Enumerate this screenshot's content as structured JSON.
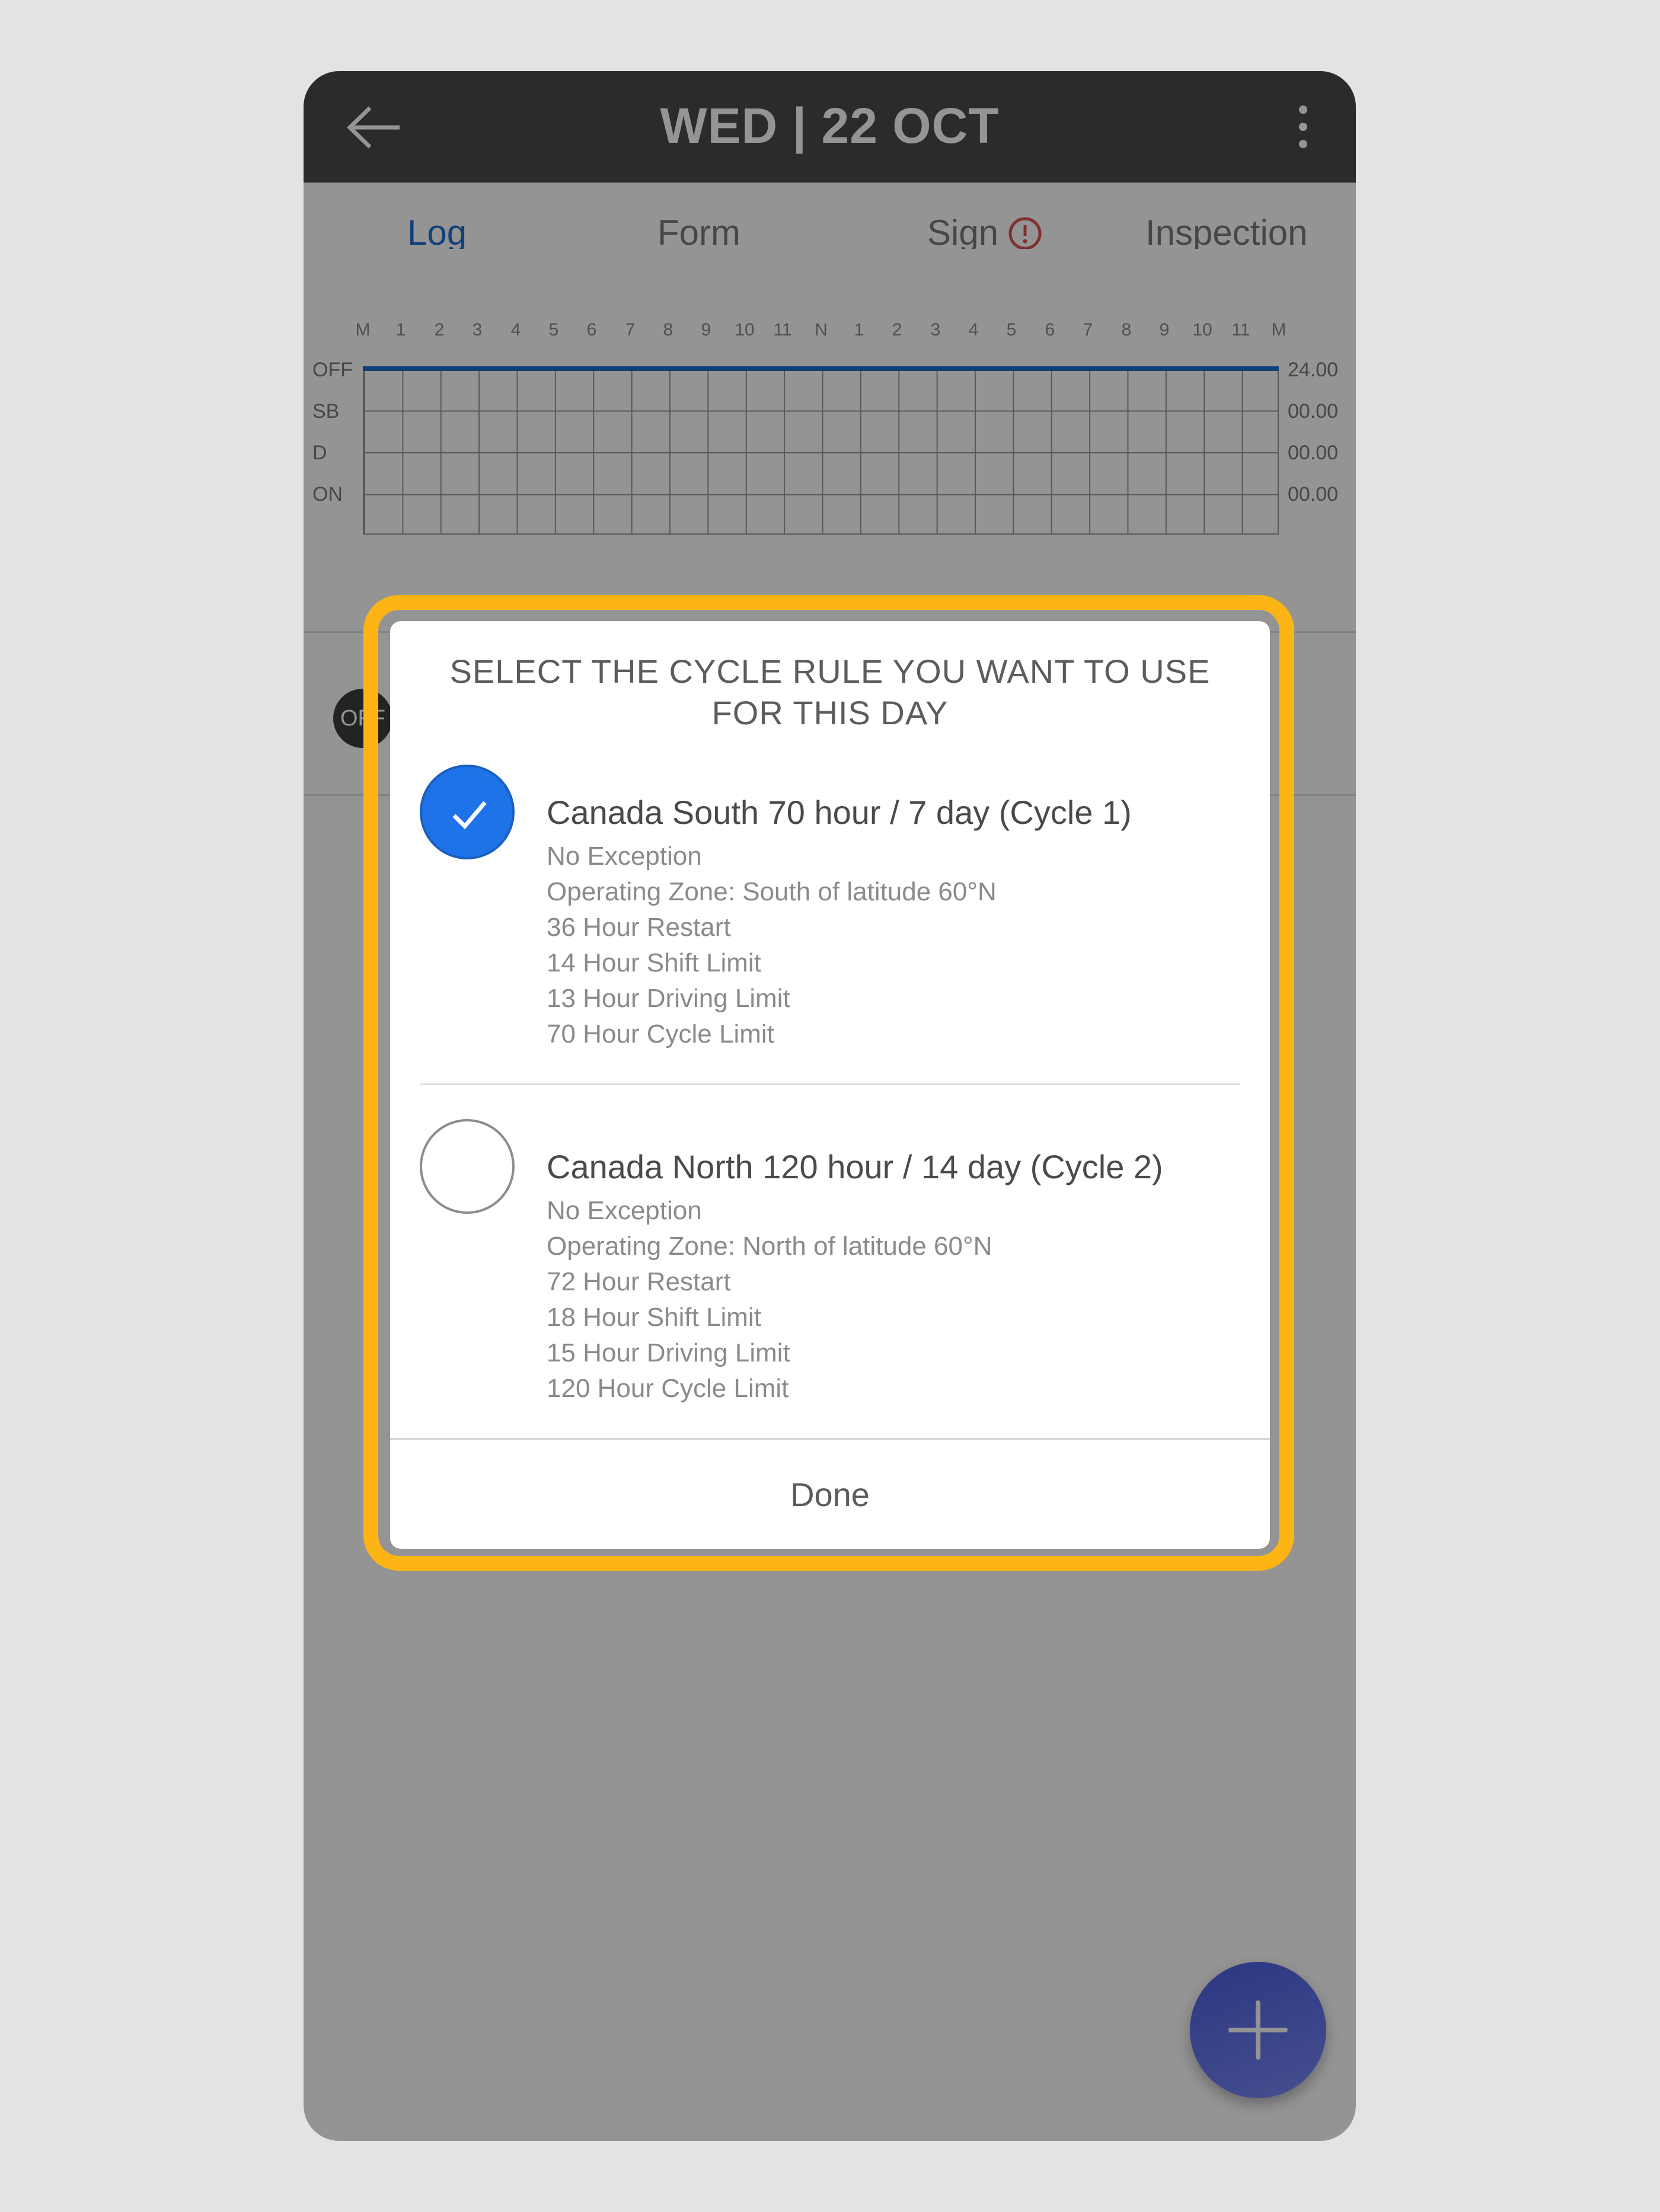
{
  "appbar": {
    "title": "WED | 22 OCT"
  },
  "tabs": [
    {
      "label": "Log",
      "active": true
    },
    {
      "label": "Form"
    },
    {
      "label": "Sign"
    },
    {
      "label": "Inspection"
    }
  ],
  "graph": {
    "hours": [
      "M",
      "1",
      "2",
      "3",
      "4",
      "5",
      "6",
      "7",
      "8",
      "9",
      "10",
      "11",
      "N",
      "1",
      "2",
      "3",
      "4",
      "5",
      "6",
      "7",
      "8",
      "9",
      "10",
      "11",
      "M"
    ],
    "rows": [
      {
        "label": "OFF",
        "total": "24.00"
      },
      {
        "label": "SB",
        "total": "00.00"
      },
      {
        "label": "D",
        "total": "00.00"
      },
      {
        "label": "ON",
        "total": "00.00"
      }
    ],
    "line_color": "#1e6fd0"
  },
  "event": {
    "badge": "OFF"
  },
  "dialog": {
    "title": "SELECT THE CYCLE RULE YOU WANT TO USE FOR THIS DAY",
    "options": [
      {
        "title": "Canada South 70 hour / 7 day (Cycle 1)",
        "checked": true,
        "details": [
          "No Exception",
          "Operating Zone: South of latitude 60°N",
          "36 Hour Restart",
          "14 Hour Shift Limit",
          "13 Hour Driving Limit",
          "70 Hour Cycle Limit"
        ]
      },
      {
        "title": "Canada North 120 hour / 14 day (Cycle 2)",
        "checked": false,
        "details": [
          "No Exception",
          "Operating Zone: North of latitude 60°N",
          "72 Hour Restart",
          "18 Hour Shift Limit",
          "15 Hour Driving Limit",
          "120 Hour Cycle Limit"
        ]
      }
    ],
    "done_label": "Done"
  },
  "colors": {
    "accent": "#1e73e8",
    "highlight": "#fdb515",
    "appbar": "#4a4a4a",
    "alert": "#d9534f"
  }
}
